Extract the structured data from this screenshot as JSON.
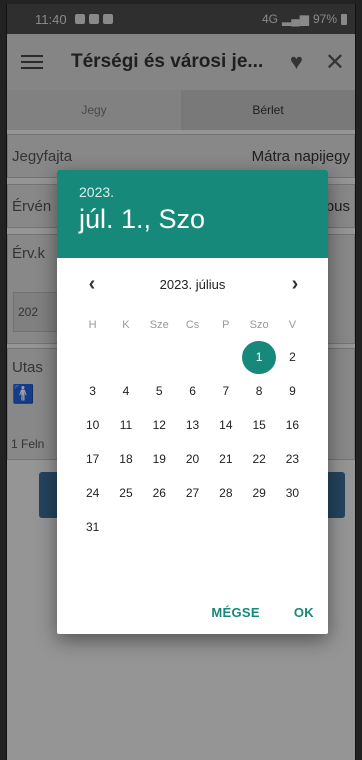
{
  "status_bar": {
    "time": "11:40",
    "network": "4G",
    "battery": "97%"
  },
  "app_bar": {
    "title": "Térségi és városi je..."
  },
  "tabs": [
    {
      "label": "Jegy"
    },
    {
      "label": "Bérlet"
    }
  ],
  "form": {
    "ticket_type_label": "Jegyfajta",
    "ticket_type_value": "Mátra napijegy",
    "validity_label": "Érvén",
    "validity_value": "típus",
    "valid_from_label": "Érv.k",
    "valid_from_value": "202",
    "passengers_label": "Utas",
    "passenger_summary": "1 Feln"
  },
  "date_picker": {
    "header_year": "2023.",
    "header_date": "júl. 1., Szo",
    "month_label": "2023. július",
    "weekdays": [
      "H",
      "K",
      "Sze",
      "Cs",
      "P",
      "Szo",
      "V"
    ],
    "weeks": [
      [
        "",
        "",
        "",
        "",
        "",
        "1",
        "2"
      ],
      [
        "3",
        "4",
        "5",
        "6",
        "7",
        "8",
        "9"
      ],
      [
        "10",
        "11",
        "12",
        "13",
        "14",
        "15",
        "16"
      ],
      [
        "17",
        "18",
        "19",
        "20",
        "21",
        "22",
        "23"
      ],
      [
        "24",
        "25",
        "26",
        "27",
        "28",
        "29",
        "30"
      ],
      [
        "31",
        "",
        "",
        "",
        "",
        "",
        ""
      ]
    ],
    "selected_day": "1",
    "cancel_label": "MÉGSE",
    "ok_label": "OK",
    "accent_color": "#17897b"
  }
}
